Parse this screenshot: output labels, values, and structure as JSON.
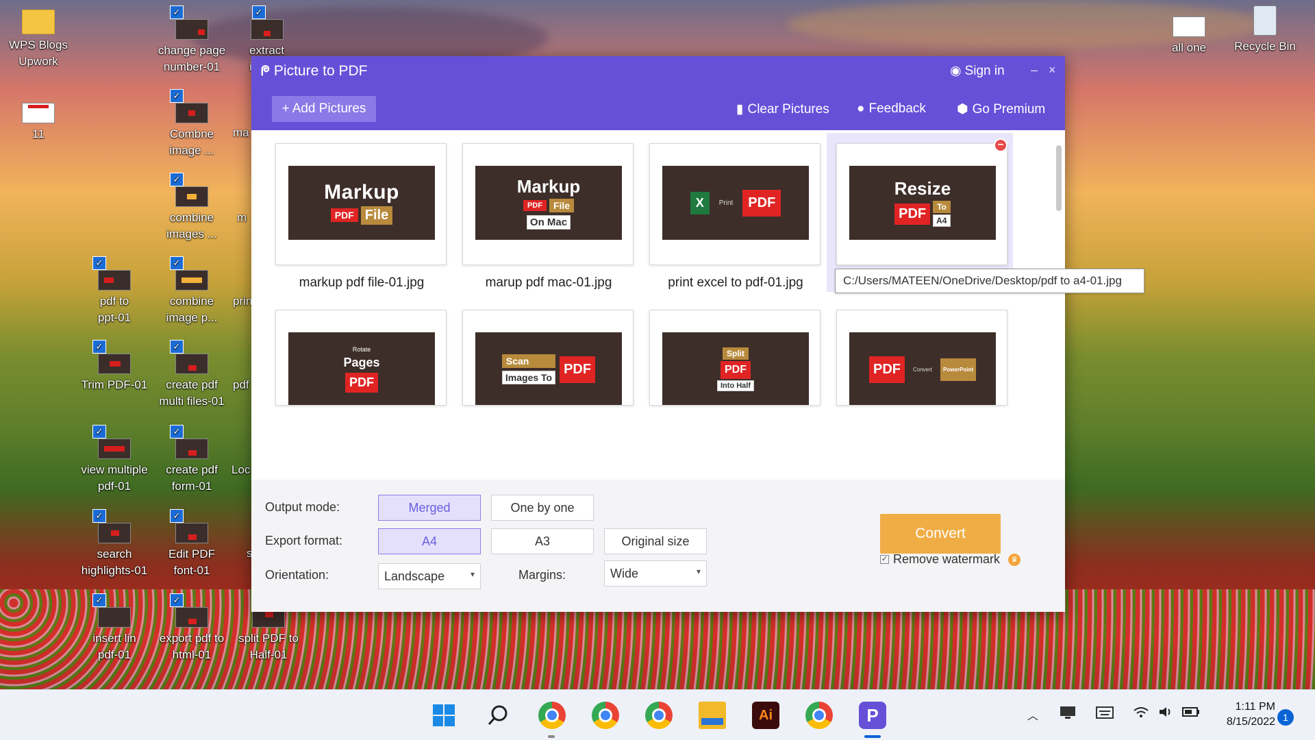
{
  "desktop": {
    "icons_left": [
      {
        "label": "WPS Blogs\nUpwork"
      },
      {
        "label": "11"
      }
    ],
    "icons_col2": [
      {
        "label": "change page\nnumber-01"
      },
      {
        "label": "Combne\nimage ..."
      },
      {
        "label": "combine\nimages ..."
      },
      {
        "label": "combine\nimage p..."
      },
      {
        "label": "create pdf\nmulti files-01"
      },
      {
        "label": "create pdf\nform-01"
      },
      {
        "label": "Edit PDF\nfont-01"
      },
      {
        "label": "export pdf to\nhtml-01"
      }
    ],
    "icons_col1": [
      {
        "label": "pdf to\nppt-01"
      },
      {
        "label": "Trim PDF-01"
      },
      {
        "label": "view multiple\npdf-01"
      },
      {
        "label": "search\nhighlights-01"
      },
      {
        "label": "insert lin\npdf-01"
      }
    ],
    "icons_col3": [
      {
        "label": "extract\nima"
      },
      {
        "label": "split PDF to\nHalf-01"
      }
    ],
    "icons_partial": [
      "ma",
      "m",
      "prin",
      "pdf",
      "Loc",
      "s"
    ],
    "icons_right": [
      {
        "label": "all one"
      },
      {
        "label": "Recycle Bin"
      }
    ]
  },
  "app": {
    "title": "Picture to PDF",
    "signin": "Sign in",
    "minimize": "–",
    "close": "×",
    "add_pictures": "Add Pictures",
    "clear_pictures": "Clear Pictures",
    "feedback": "Feedback",
    "go_premium": "Go Premium",
    "thumbnails": [
      {
        "caption": "markup pdf file-01.jpg",
        "art": {
          "line1": "Markup",
          "pdf": "PDF",
          "tag": "File"
        }
      },
      {
        "caption": "marup pdf mac-01.jpg",
        "art": {
          "line1": "Markup",
          "pdf": "PDF",
          "tag": "File",
          "tag2": "On Mac"
        }
      },
      {
        "caption": "print excel to pdf-01.jpg",
        "art": {
          "x": "X",
          "small": "Print",
          "pdf": "PDF"
        }
      },
      {
        "caption": "",
        "selected": true,
        "art": {
          "line1": "Resize",
          "pdf": "PDF",
          "tag": "To",
          "tag2": "A4"
        }
      },
      {
        "caption": "",
        "art": {
          "small": "Rotate",
          "line1": "Pages",
          "pdf": "PDF"
        }
      },
      {
        "caption": "",
        "art": {
          "tag": "Scan",
          "tag2": "Images To",
          "pdf": "PDF"
        }
      },
      {
        "caption": "",
        "art": {
          "tag": "Split",
          "pdf": "PDF",
          "tag2": "Into Half"
        }
      },
      {
        "caption": "",
        "art": {
          "pdf": "PDF",
          "small": "Convert",
          "tag": "PowerPoint"
        }
      }
    ],
    "tooltip": "C:/Users/MATEEN/OneDrive/Desktop/pdf to a4-01.jpg",
    "options": {
      "output_mode_label": "Output mode:",
      "output_mode_options": [
        "Merged",
        "One by one"
      ],
      "output_mode_selected": "Merged",
      "export_format_label": "Export format:",
      "export_format_options": [
        "A4",
        "A3",
        "Original size"
      ],
      "export_format_selected": "A4",
      "orientation_label": "Orientation:",
      "orientation_value": "Landscape",
      "margins_label": "Margins:",
      "margins_value": "Wide",
      "convert": "Convert",
      "remove_watermark": "Remove watermark",
      "remove_watermark_checked": true
    }
  },
  "taskbar": {
    "apps": [
      "start-icon",
      "search-icon",
      "chrome-icon",
      "chrome-icon",
      "chrome-icon",
      "file-explorer-icon",
      "illustrator-icon",
      "chrome-icon",
      "wps-pdf-icon"
    ],
    "illustrator_label": "Ai",
    "wps_label": "P",
    "time": "1:11 PM",
    "date": "8/15/2022",
    "notifications": "1"
  },
  "colors": {
    "titlebar": "#6650d8",
    "convert": "#f0ad45",
    "active_segment": "#e4e0fb"
  }
}
